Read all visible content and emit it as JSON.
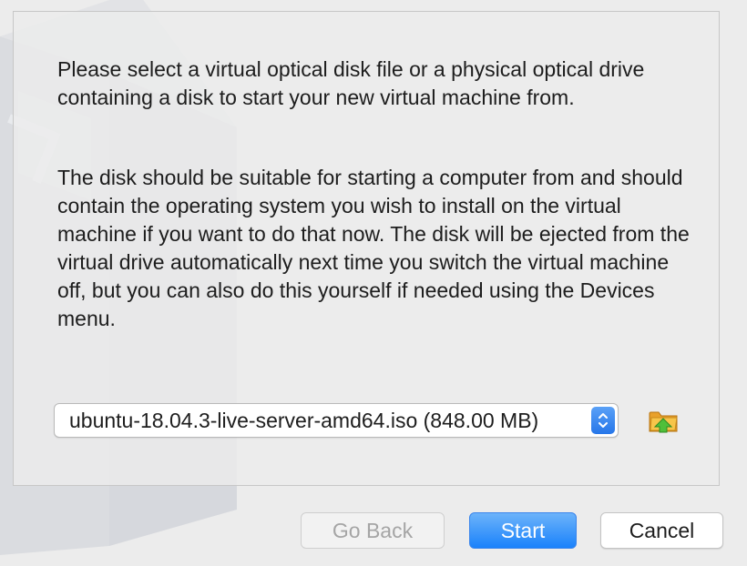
{
  "dialog": {
    "paragraph_1": "Please select a virtual optical disk file or a physical optical drive containing a disk to start your new virtual machine from.",
    "paragraph_2": "The disk should be suitable for starting a computer from and should contain the operating system you wish to install on the virtual machine if you want to do that now. The disk will be ejected from the virtual drive automatically next time you switch the virtual machine off, but you can also do this yourself if needed using the Devices menu."
  },
  "disk_select": {
    "value": "ubuntu-18.04.3-live-server-amd64.iso (848.00 MB)",
    "stepper_icon": "up-down-chevron-icon"
  },
  "folder_button": {
    "icon": "folder-open-icon"
  },
  "buttons": {
    "go_back": "Go Back",
    "start": "Start",
    "cancel": "Cancel"
  },
  "colors": {
    "accent": "#1a82fb",
    "background": "#ececec",
    "disabled_text": "#a5a5a5"
  }
}
